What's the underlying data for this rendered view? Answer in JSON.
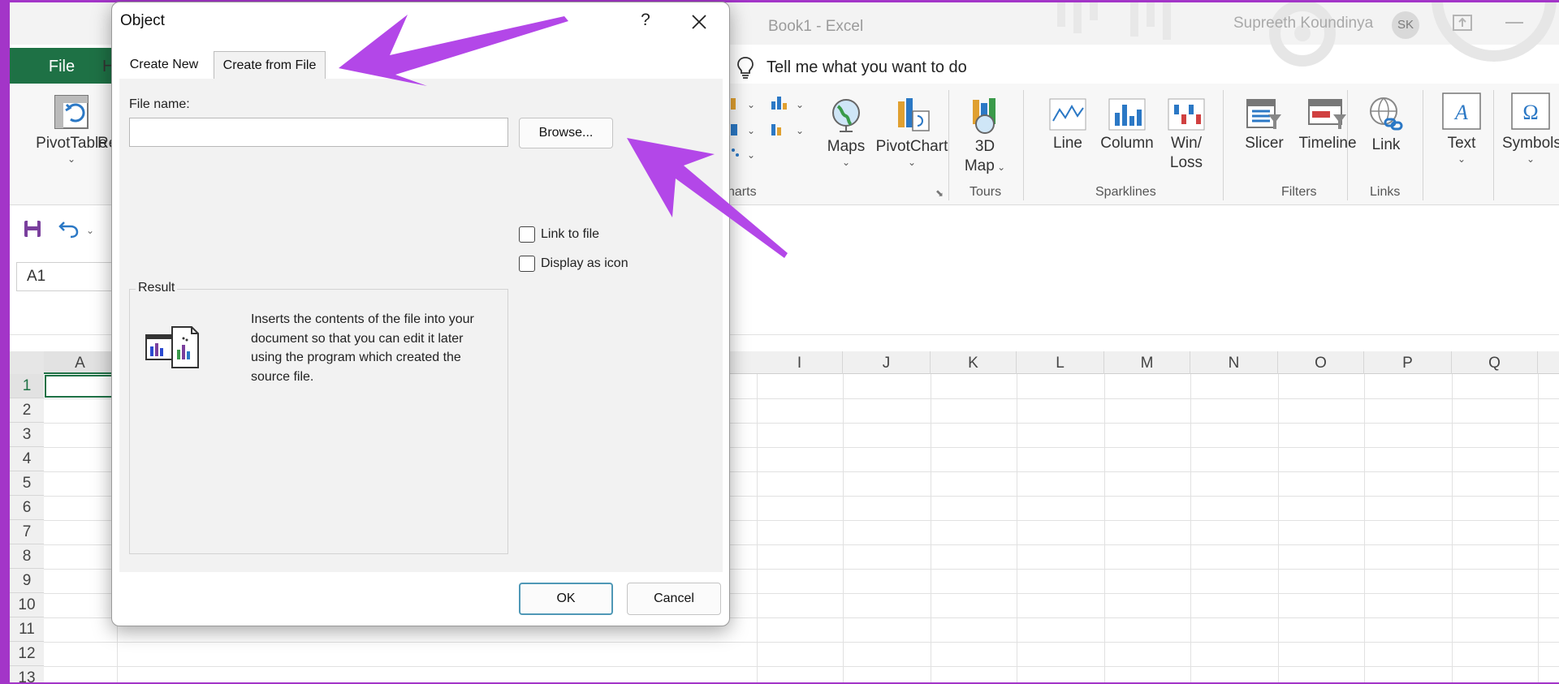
{
  "excel": {
    "title": "Book1  -  Excel",
    "user_name": "Supreeth Koundinya",
    "user_initials": "SK",
    "tabs": {
      "file": "File",
      "home": "H"
    },
    "tell_me": "Tell me what you want to do",
    "name_box": "A1",
    "ribbon": {
      "pivottable": "PivotTable",
      "recommended_partial": "Re",
      "maps": "Maps",
      "pivotchart": "PivotChart",
      "map3d_line1": "3D",
      "map3d_line2": "Map",
      "line": "Line",
      "column": "Column",
      "winloss_line1": "Win/",
      "winloss_line2": "Loss",
      "slicer": "Slicer",
      "timeline": "Timeline",
      "link": "Link",
      "text": "Text",
      "symbols": "Symbols",
      "groups": {
        "charts": "harts",
        "tours": "Tours",
        "sparklines": "Sparklines",
        "filters": "Filters",
        "links": "Links"
      }
    },
    "columns": [
      "A",
      "I",
      "J",
      "K",
      "L",
      "M",
      "N",
      "O",
      "P",
      "Q"
    ],
    "rows": [
      "1",
      "2",
      "3",
      "4",
      "5",
      "6",
      "7",
      "8",
      "9",
      "10",
      "11",
      "12",
      "13"
    ]
  },
  "dialog": {
    "title": "Object",
    "help": "?",
    "tabs": {
      "create_new": "Create New",
      "create_from_file": "Create from File"
    },
    "file_name_label": "File name:",
    "file_name_value": "",
    "browse": "Browse...",
    "link_to_file": "Link to file",
    "display_as_icon": "Display as icon",
    "result_label": "Result",
    "result_text": "Inserts the contents of the file into your document so that you can edit it later using the program which created the source file.",
    "ok": "OK",
    "cancel": "Cancel"
  },
  "colors": {
    "excel_green": "#1e7145",
    "annotation_arrow": "#b347e8",
    "frame": "#a335c8"
  }
}
